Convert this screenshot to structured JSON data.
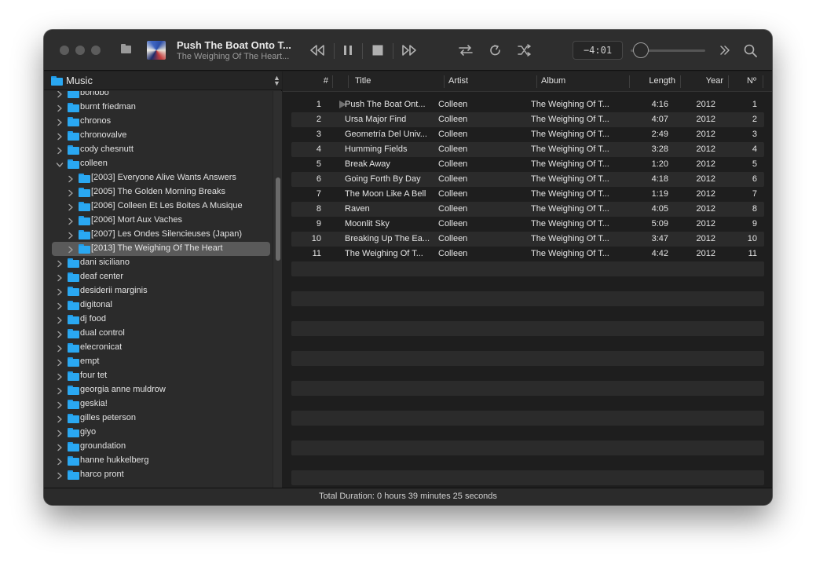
{
  "now_playing": {
    "title": "Push The Boat Onto T...",
    "subtitle": "The Weighing Of The Heart...",
    "time_remaining": "−4:01",
    "volume_fraction": 0.0
  },
  "icons": {
    "open": "folder-icon",
    "rewind": "rewind-icon",
    "pause": "pause-icon",
    "stop": "stop-icon",
    "fast_forward": "fast-forward-icon",
    "repeat_all": "repeat-icon",
    "repeat_one": "repeat-one-icon",
    "shuffle": "shuffle-icon",
    "expand": "double-chevron-right-icon",
    "search": "search-icon"
  },
  "sidebar": {
    "title": "Music",
    "items": [
      {
        "label": "bonobo",
        "level": 0,
        "expanded": false
      },
      {
        "label": "burnt friedman",
        "level": 0,
        "expanded": false
      },
      {
        "label": "chronos",
        "level": 0,
        "expanded": false
      },
      {
        "label": "chronovalve",
        "level": 0,
        "expanded": false
      },
      {
        "label": "cody chesnutt",
        "level": 0,
        "expanded": false
      },
      {
        "label": "colleen",
        "level": 0,
        "expanded": true
      },
      {
        "label": "[2003] Everyone Alive Wants Answers",
        "level": 1,
        "expanded": false
      },
      {
        "label": "[2005] The Golden Morning Breaks",
        "level": 1,
        "expanded": false
      },
      {
        "label": "[2006] Colleen Et Les Boites A Musique",
        "level": 1,
        "expanded": false
      },
      {
        "label": "[2006] Mort Aux Vaches",
        "level": 1,
        "expanded": false
      },
      {
        "label": "[2007] Les Ondes Silencieuses (Japan)",
        "level": 1,
        "expanded": false
      },
      {
        "label": "[2013] The Weighing Of The Heart",
        "level": 1,
        "expanded": false,
        "selected": true
      },
      {
        "label": "dani siciliano",
        "level": 0,
        "expanded": false
      },
      {
        "label": "deaf center",
        "level": 0,
        "expanded": false
      },
      {
        "label": "desiderii marginis",
        "level": 0,
        "expanded": false
      },
      {
        "label": "digitonal",
        "level": 0,
        "expanded": false
      },
      {
        "label": "dj food",
        "level": 0,
        "expanded": false
      },
      {
        "label": "dual control",
        "level": 0,
        "expanded": false
      },
      {
        "label": "elecronicat",
        "level": 0,
        "expanded": false
      },
      {
        "label": "empt",
        "level": 0,
        "expanded": false
      },
      {
        "label": "four tet",
        "level": 0,
        "expanded": false
      },
      {
        "label": "georgia anne muldrow",
        "level": 0,
        "expanded": false
      },
      {
        "label": "geskia!",
        "level": 0,
        "expanded": false
      },
      {
        "label": "gilles peterson",
        "level": 0,
        "expanded": false
      },
      {
        "label": "giyo",
        "level": 0,
        "expanded": false
      },
      {
        "label": "groundation",
        "level": 0,
        "expanded": false
      },
      {
        "label": "hanne hukkelberg",
        "level": 0,
        "expanded": false
      },
      {
        "label": "harco pront",
        "level": 0,
        "expanded": false
      }
    ]
  },
  "tracklist": {
    "columns": [
      "#",
      "Title",
      "Artist",
      "Album",
      "Length",
      "Year",
      "Nº"
    ],
    "playing_index": 0,
    "tracks": [
      {
        "num": "1",
        "title": "Push The Boat Ont...",
        "artist": "Colleen",
        "album": "The Weighing Of T...",
        "length": "4:16",
        "year": "2012",
        "no": "1"
      },
      {
        "num": "2",
        "title": "Ursa Major Find",
        "artist": "Colleen",
        "album": "The Weighing Of T...",
        "length": "4:07",
        "year": "2012",
        "no": "2"
      },
      {
        "num": "3",
        "title": "Geometría Del Univ...",
        "artist": "Colleen",
        "album": "The Weighing Of T...",
        "length": "2:49",
        "year": "2012",
        "no": "3"
      },
      {
        "num": "4",
        "title": "Humming Fields",
        "artist": "Colleen",
        "album": "The Weighing Of T...",
        "length": "3:28",
        "year": "2012",
        "no": "4"
      },
      {
        "num": "5",
        "title": "Break Away",
        "artist": "Colleen",
        "album": "The Weighing Of T...",
        "length": "1:20",
        "year": "2012",
        "no": "5"
      },
      {
        "num": "6",
        "title": "Going Forth By Day",
        "artist": "Colleen",
        "album": "The Weighing Of T...",
        "length": "4:18",
        "year": "2012",
        "no": "6"
      },
      {
        "num": "7",
        "title": "The Moon Like A Bell",
        "artist": "Colleen",
        "album": "The Weighing Of T...",
        "length": "1:19",
        "year": "2012",
        "no": "7"
      },
      {
        "num": "8",
        "title": "Raven",
        "artist": "Colleen",
        "album": "The Weighing Of T...",
        "length": "4:05",
        "year": "2012",
        "no": "8"
      },
      {
        "num": "9",
        "title": "Moonlit Sky",
        "artist": "Colleen",
        "album": "The Weighing Of T...",
        "length": "5:09",
        "year": "2012",
        "no": "9"
      },
      {
        "num": "10",
        "title": "Breaking Up The Ea...",
        "artist": "Colleen",
        "album": "The Weighing Of T...",
        "length": "3:47",
        "year": "2012",
        "no": "10"
      },
      {
        "num": "11",
        "title": "The Weighing Of T...",
        "artist": "Colleen",
        "album": "The Weighing Of T...",
        "length": "4:42",
        "year": "2012",
        "no": "11"
      }
    ]
  },
  "status": {
    "text": "Total Duration: 0 hours 39 minutes 25 seconds"
  }
}
